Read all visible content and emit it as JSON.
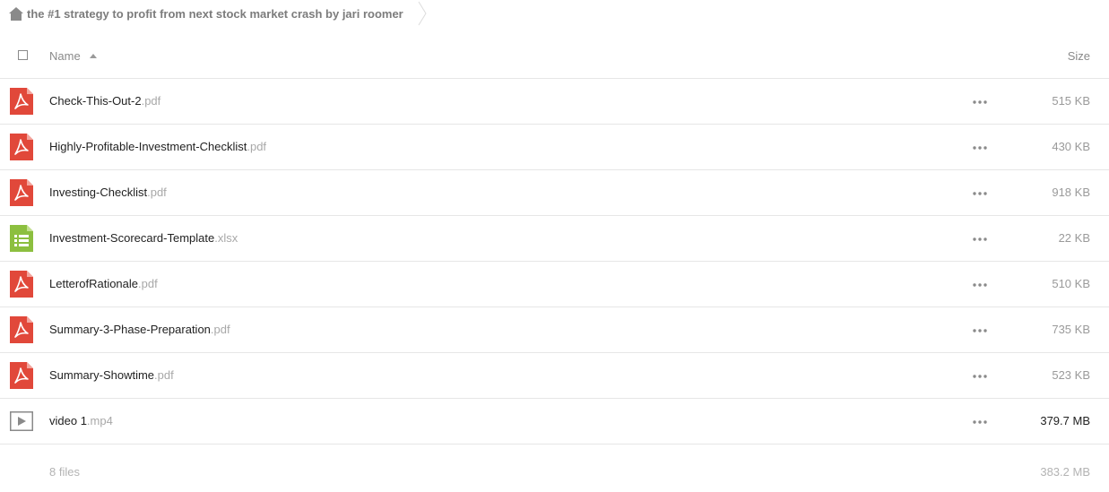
{
  "breadcrumb": {
    "folder": "the #1 strategy to profit from next stock market crash by jari roomer"
  },
  "header": {
    "name_label": "Name",
    "size_label": "Size"
  },
  "files": [
    {
      "name": "Check-This-Out-2",
      "ext": ".pdf",
      "size": "515 KB",
      "icon": "pdf-icon"
    },
    {
      "name": "Highly-Profitable-Investment-Checklist",
      "ext": ".pdf",
      "size": "430 KB",
      "icon": "pdf-icon"
    },
    {
      "name": "Investing-Checklist",
      "ext": ".pdf",
      "size": "918 KB",
      "icon": "pdf-icon"
    },
    {
      "name": "Investment-Scorecard-Template",
      "ext": ".xlsx",
      "size": "22 KB",
      "icon": "spreadsheet-icon"
    },
    {
      "name": "LetterofRationale",
      "ext": ".pdf",
      "size": "510 KB",
      "icon": "pdf-icon"
    },
    {
      "name": "Summary-3-Phase-Preparation",
      "ext": ".pdf",
      "size": "735 KB",
      "icon": "pdf-icon"
    },
    {
      "name": "Summary-Showtime",
      "ext": ".pdf",
      "size": "523 KB",
      "icon": "pdf-icon"
    },
    {
      "name": "video 1",
      "ext": ".mp4",
      "size": "379.7 MB",
      "icon": "video-icon"
    }
  ],
  "summary": {
    "file_count": "8 files",
    "total_size": "383.2 MB"
  },
  "colors": {
    "pdf": "#e1483a",
    "spreadsheet": "#8cbf3f",
    "video": "#8a8a8a"
  }
}
